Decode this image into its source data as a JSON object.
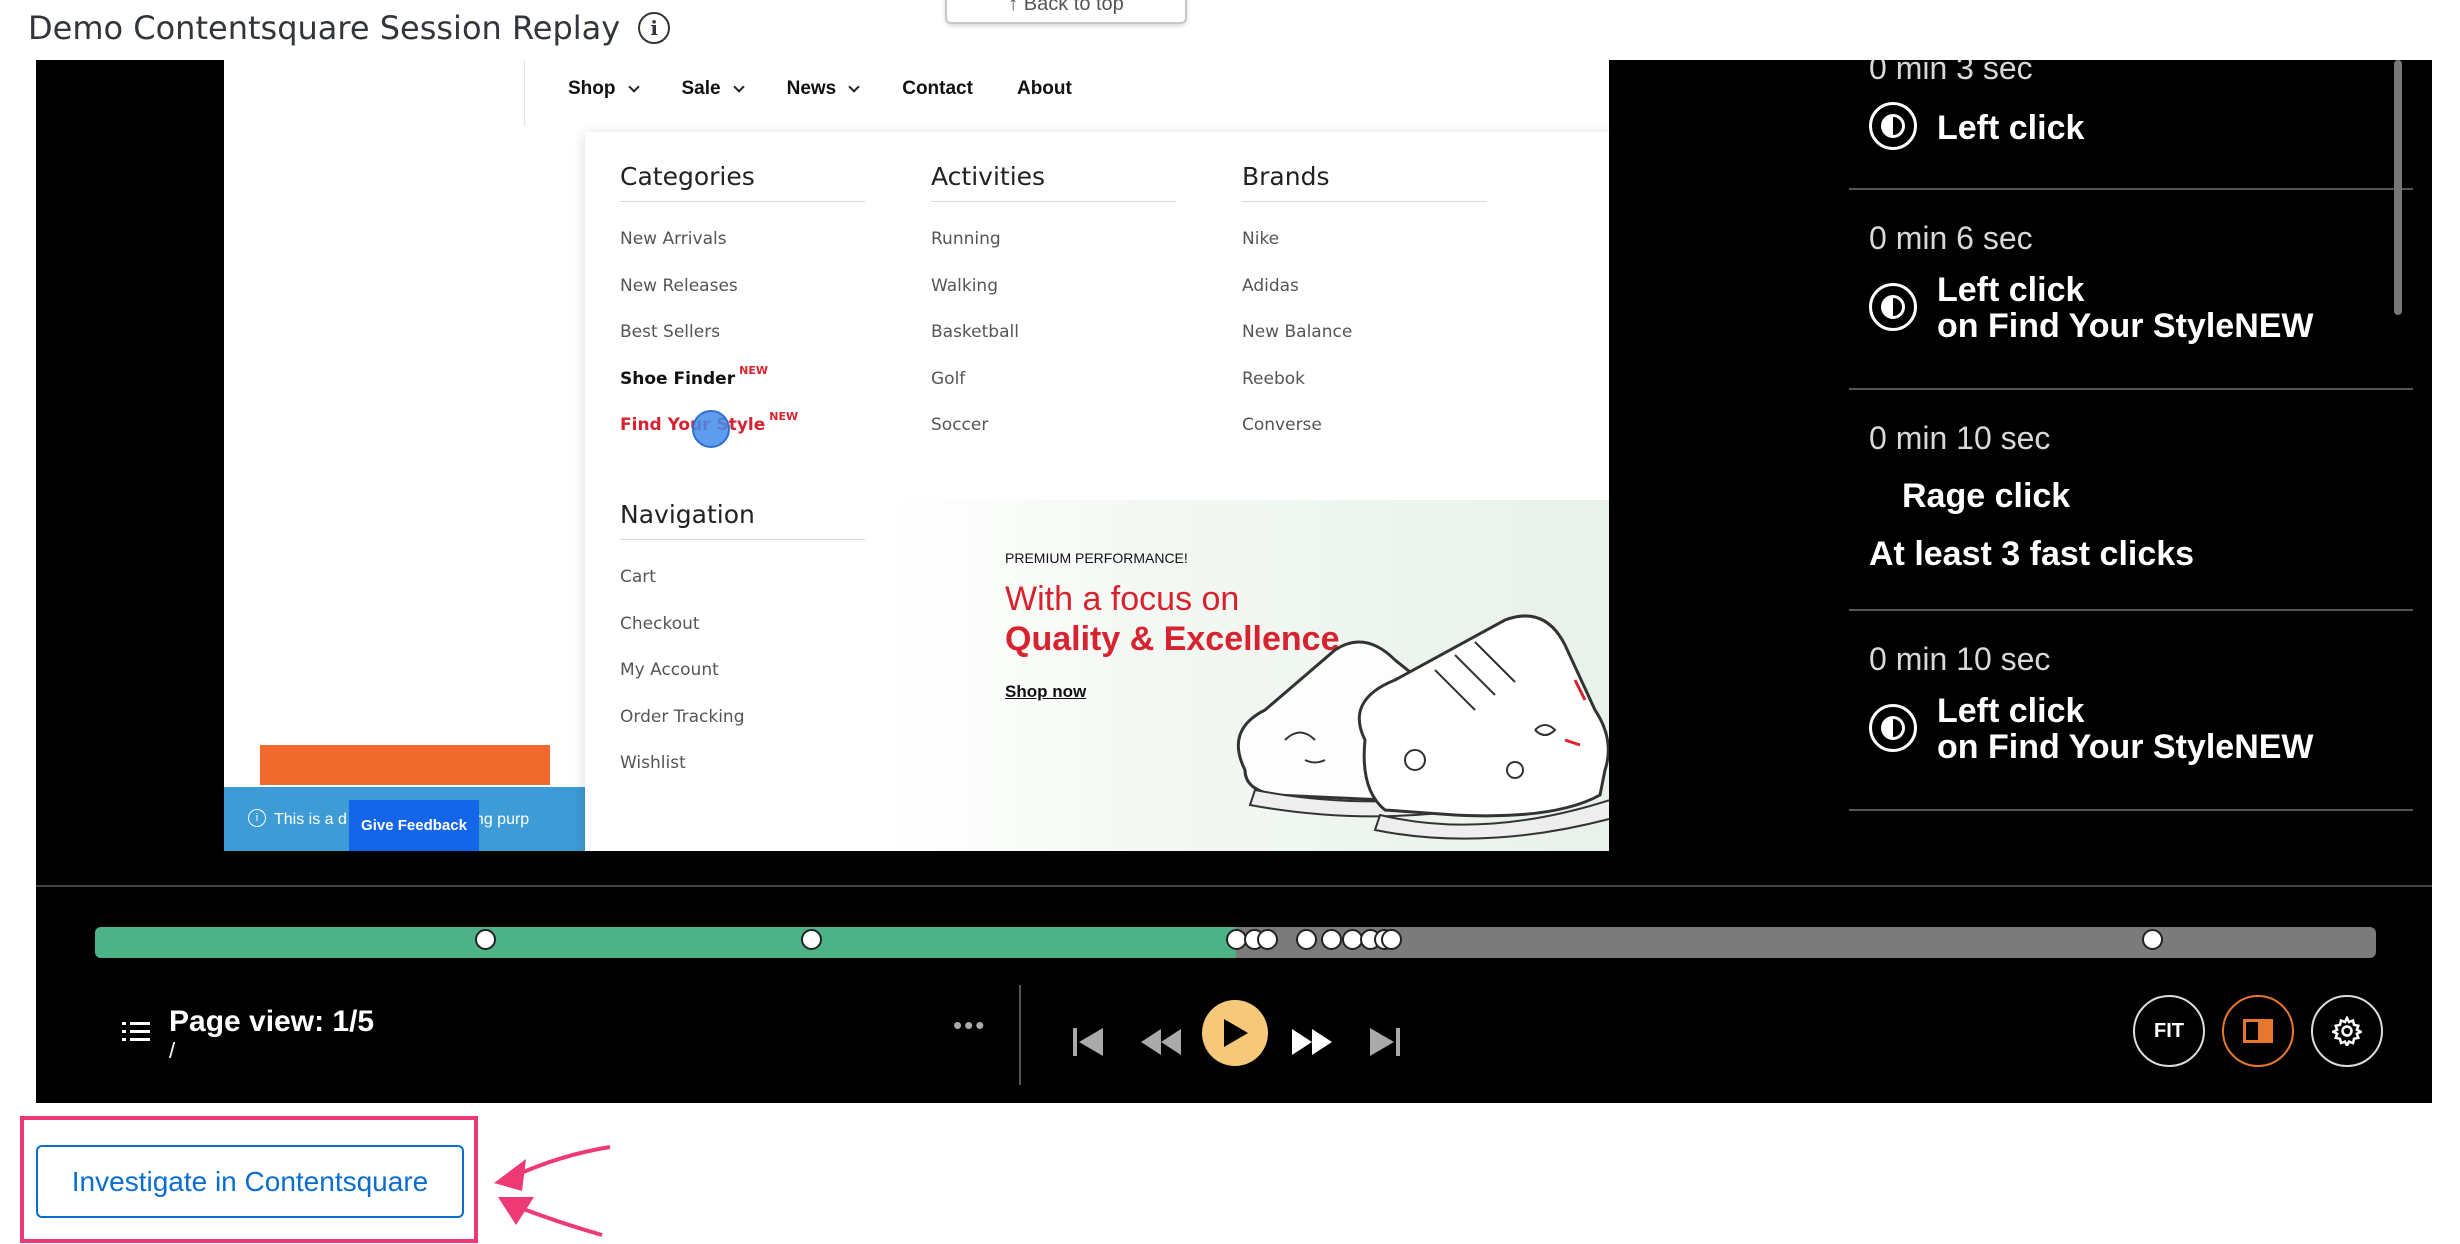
{
  "header": {
    "title": "Demo Contentsquare Session Replay",
    "info_glyph": "i",
    "back_to_top": "↑ Back to top"
  },
  "site": {
    "nav": [
      "Shop",
      "Sale",
      "News",
      "Contact",
      "About"
    ],
    "menu": {
      "categories": {
        "title": "Categories",
        "items": [
          "New Arrivals",
          "New Releases",
          "Best Sellers",
          "Shoe Finder",
          "Find Your Style"
        ],
        "new_badge": "NEW"
      },
      "activities": {
        "title": "Activities",
        "items": [
          "Running",
          "Walking",
          "Basketball",
          "Golf",
          "Soccer"
        ]
      },
      "brands": {
        "title": "Brands",
        "items": [
          "Nike",
          "Adidas",
          "New Balance",
          "Reebok",
          "Converse"
        ]
      },
      "navigation": {
        "title": "Navigation",
        "items": [
          "Cart",
          "Checkout",
          "My Account",
          "Order Tracking",
          "Wishlist"
        ]
      }
    },
    "promo": {
      "kicker": "PREMIUM PERFORMANCE!",
      "line1": "With a focus on",
      "line2": "Quality & Excellence",
      "link": "Shop now"
    },
    "info_bar": {
      "text_left": "This is a d",
      "text_right": "sting purp",
      "icon": "i"
    },
    "feedback_label": "Give Feedback"
  },
  "events": [
    {
      "time": "0 min 3 sec",
      "label": "Left click",
      "detail": ""
    },
    {
      "time": "0 min 6 sec",
      "label": "Left click",
      "detail": "on Find Your StyleNEW"
    },
    {
      "time": "0 min 10 sec",
      "label": "Rage click",
      "detail": "At least 3 fast clicks"
    },
    {
      "time": "0 min 10 sec",
      "label": "Left click",
      "detail": "on Find Your StyleNEW"
    }
  ],
  "timeline": {
    "progress_fraction": 0.5,
    "event_positions": [
      0.171,
      0.314,
      0.5,
      0.508,
      0.514,
      0.531,
      0.542,
      0.551,
      0.559,
      0.565,
      0.568,
      0.902
    ]
  },
  "controls": {
    "page_view_label": "Page view: 1/5",
    "page_path": "/",
    "more": "•••",
    "fit_label": "FIT"
  },
  "colors": {
    "timeline_progress": "#4db287",
    "timeline_track": "#7b7b7b",
    "play": "#f6c87a",
    "accent": "#e8772e",
    "link_blue": "#0a6ed1",
    "highlight_pink": "#ed3a74",
    "brand_red": "#d6232f"
  },
  "investigate": {
    "label": "Investigate in Contentsquare"
  }
}
